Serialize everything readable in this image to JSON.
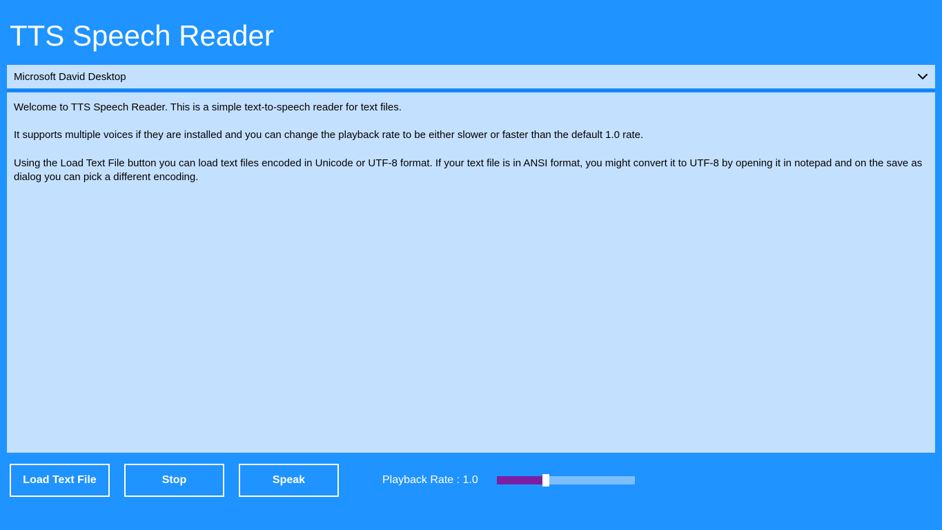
{
  "header": {
    "title": "TTS Speech Reader"
  },
  "voice_selector": {
    "selected": "Microsoft David Desktop"
  },
  "text_content": {
    "p1": "Welcome to TTS Speech Reader.  This is a simple text-to-speech reader for text files.",
    "p2": "It supports multiple voices if they are installed and you can change the playback rate to be either slower or faster than the default 1.0 rate.",
    "p3": "Using the Load Text File button you can load text files encoded in Unicode or UTF-8 format.  If your text file is in ANSI format, you might convert it to UTF-8 by opening it in notepad and on the save as dialog you can pick a different encoding."
  },
  "buttons": {
    "load": "Load Text File",
    "stop": "Stop",
    "speak": "Speak"
  },
  "playback": {
    "label": "Playback Rate : 1.0",
    "rate": 1.0,
    "slider_percent": 33
  },
  "colors": {
    "background": "#1f93ff",
    "panel": "#c4e0ff",
    "slider_fill": "#7b1fa2",
    "slider_track": "#7dbeff"
  }
}
